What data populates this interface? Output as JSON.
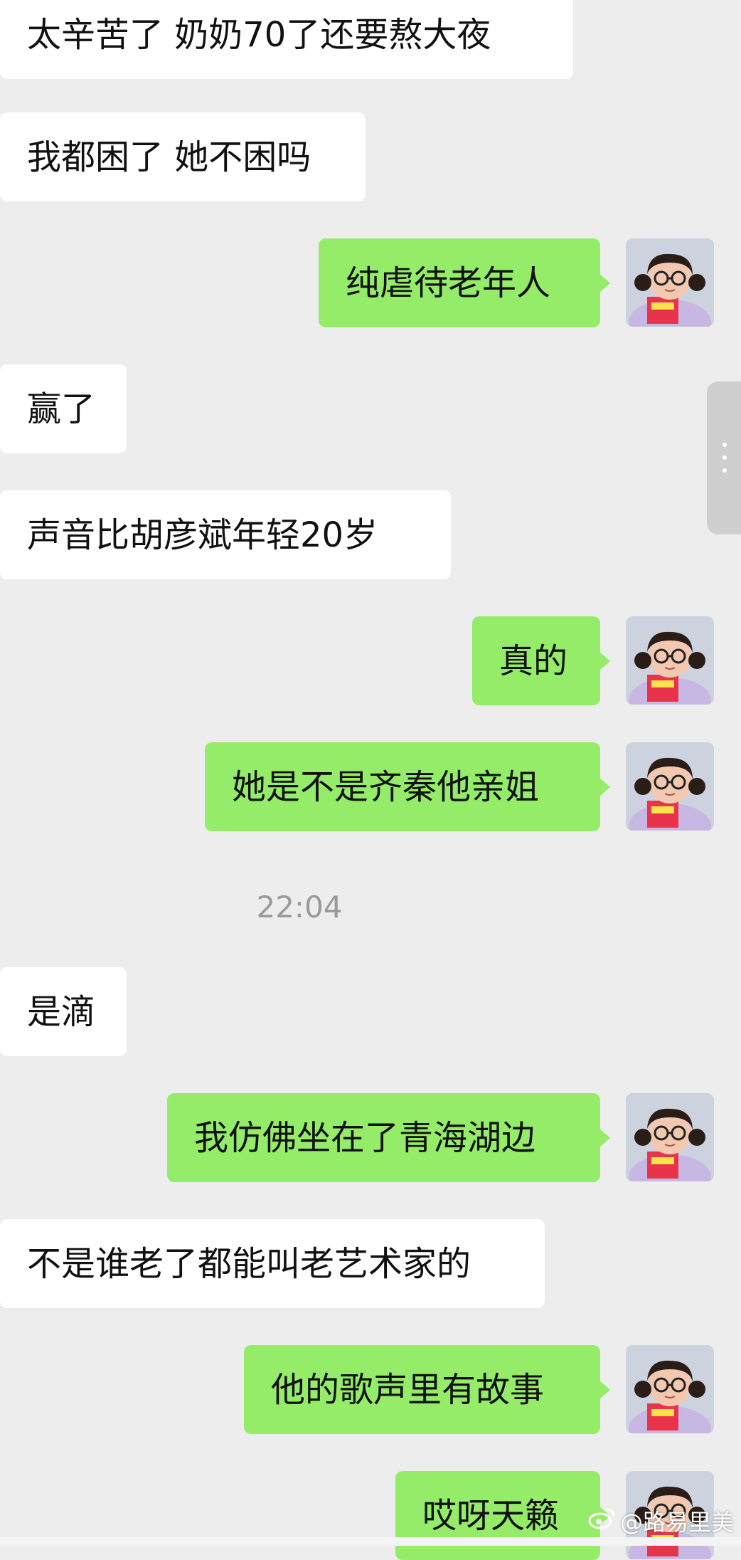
{
  "messages": [
    {
      "side": "left",
      "text": "太辛苦了 奶奶70了还要熬大夜"
    },
    {
      "side": "left",
      "text": "我都困了 她不困吗"
    },
    {
      "side": "right",
      "text": "纯虐待老年人"
    },
    {
      "side": "left",
      "text": "赢了"
    },
    {
      "side": "left",
      "text": "声音比胡彦斌年轻20岁"
    },
    {
      "side": "right",
      "text": "真的"
    },
    {
      "side": "right",
      "text": "她是不是齐秦他亲姐"
    },
    {
      "time": "22:04"
    },
    {
      "side": "left",
      "text": "是滴"
    },
    {
      "side": "right",
      "text": "我仿佛坐在了青海湖边"
    },
    {
      "side": "left",
      "text": "不是谁老了都能叫老艺术家的"
    },
    {
      "side": "right",
      "text": "他的歌声里有故事"
    },
    {
      "side": "right",
      "text": "哎呀天籁"
    }
  ],
  "watermark": {
    "text": "@路易里美",
    "icon": "weibo-icon"
  },
  "colors": {
    "background": "#ededed",
    "incoming_bubble": "#ffffff",
    "outgoing_bubble": "#95ec69",
    "timestamp": "#9a9a9a"
  }
}
